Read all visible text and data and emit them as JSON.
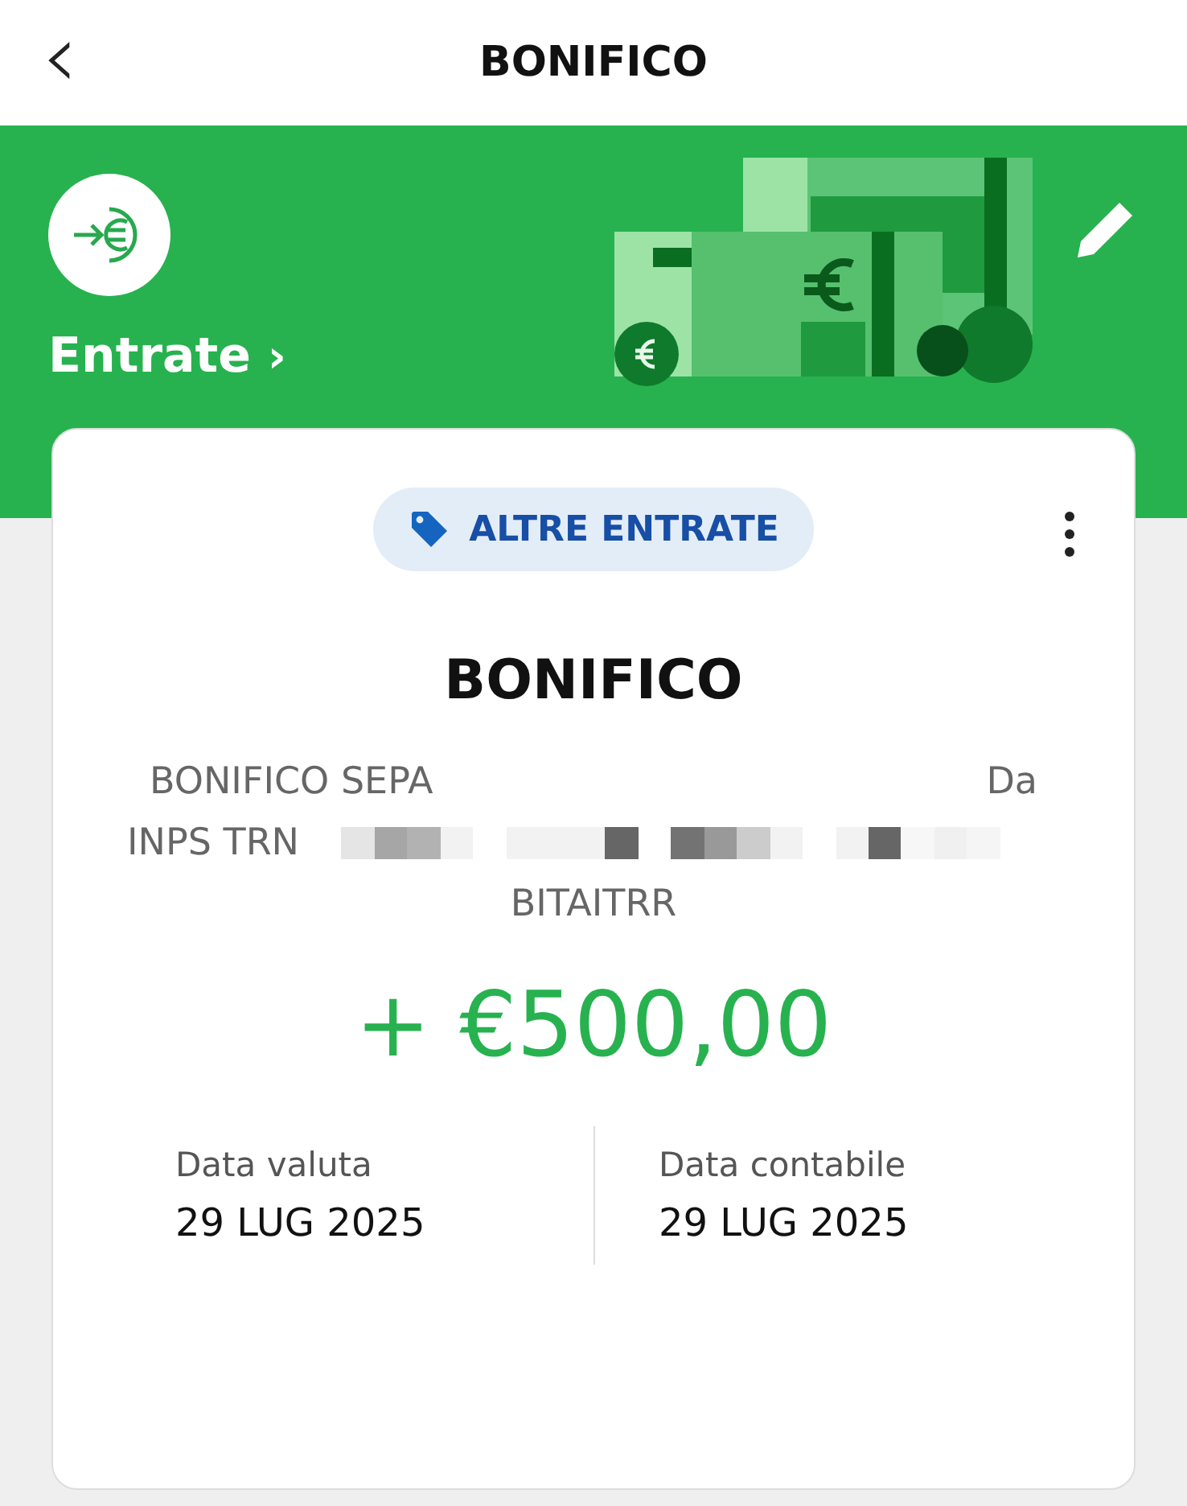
{
  "header": {
    "back_icon": "‹",
    "title": "BONIFICO"
  },
  "category": {
    "name": "Entrate",
    "chevron": "›"
  },
  "card": {
    "tag": "ALTRE ENTRATE",
    "title": "BONIFICO",
    "description": {
      "line_1_left": "BONIFICO SEPA",
      "line_1_right": "Da",
      "line_2": "INPS TRN",
      "line_3": "BITAITRR"
    },
    "amount": "+ €500,00",
    "dates": [
      {
        "label": "Data valuta",
        "value": "29 LUG 2025"
      },
      {
        "label": "Data contabile",
        "value": "29 LUG 2025"
      }
    ]
  }
}
